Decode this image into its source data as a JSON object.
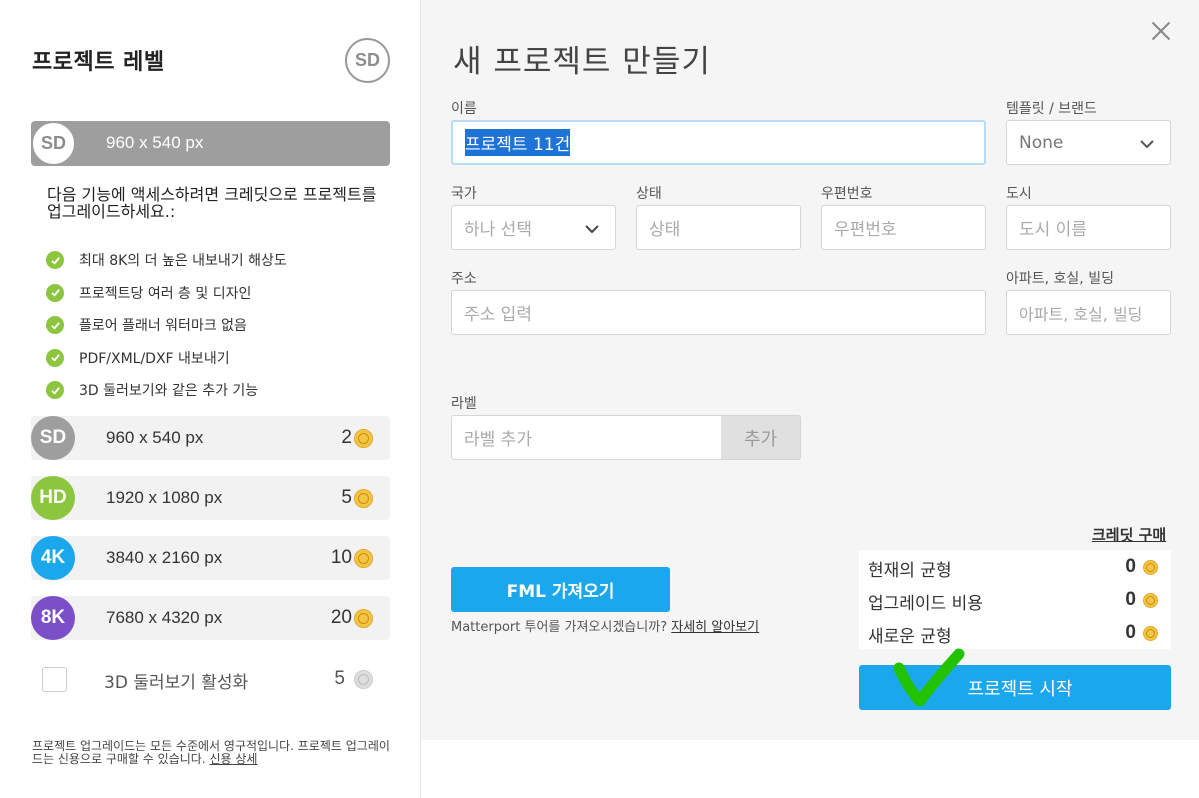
{
  "left": {
    "title": "프로젝트 레벨",
    "top_badge": "SD",
    "current": {
      "badge": "SD",
      "resolution": "960 x 540 px"
    },
    "upgrade_text": "다음 기능에 액세스하려면 크레딧으로 프로젝트를 업그레이드하세요.:",
    "features": [
      "최대 8K의 더 높은 내보내기 해상도",
      "프로젝트당 여러 층 및 디자인",
      "플로어 플래너 워터마크 없음",
      "PDF/XML/DXF 내보내기",
      "3D 둘러보기와 같은 추가 기능"
    ],
    "levels": [
      {
        "badge": "SD",
        "resolution": "960 x 540 px",
        "cost": "2",
        "color": "#9e9e9e"
      },
      {
        "badge": "HD",
        "resolution": "1920 x 1080 px",
        "cost": "5",
        "color": "#8cc63f"
      },
      {
        "badge": "4K",
        "resolution": "3840 x 2160 px",
        "cost": "10",
        "color": "#1aa7ec"
      },
      {
        "badge": "8K",
        "resolution": "7680 x 4320 px",
        "cost": "20",
        "color": "#7b4fc7"
      }
    ],
    "tour": {
      "label": "3D 둘러보기 활성화",
      "cost": "5"
    },
    "footnote": "프로젝트 업그레이드는 모든 수준에서 영구적입니다. 프로젝트 업그레이드는 신용으로 구매할 수 있습니다.",
    "footnote_link": "신용 상세"
  },
  "right": {
    "title": "새 프로젝트 만들기",
    "name": {
      "label": "이름",
      "value": "프로젝트 11건"
    },
    "template": {
      "label": "템플릿 / 브랜드",
      "value": "None"
    },
    "country": {
      "label": "국가",
      "value": "하나 선택"
    },
    "state": {
      "label": "상태",
      "placeholder": "상태"
    },
    "zip": {
      "label": "우편번호",
      "placeholder": "우편번호"
    },
    "city": {
      "label": "도시",
      "placeholder": "도시 이름"
    },
    "address": {
      "label": "주소",
      "placeholder": "주소 입력"
    },
    "apt": {
      "label": "아파트, 호실, 빌딩",
      "placeholder": "아파트, 호실, 빌딩"
    },
    "labels": {
      "label": "라벨",
      "placeholder": "라벨 추가",
      "add_button": "추가"
    },
    "fml_button": "FML 가져오기",
    "matterport_text": "Matterport 투어를 가져오시겠습니까?",
    "matterport_link": "자세히 알아보기",
    "buy_credits": "크레딧 구매",
    "balance_rows": [
      {
        "label": "현재의 균형",
        "value": "0"
      },
      {
        "label": "업그레이드 비용",
        "value": "0"
      },
      {
        "label": "새로운 균형",
        "value": "0"
      }
    ],
    "start_button": "프로젝트 시작"
  },
  "colors": {
    "accent": "#1aa7ec",
    "check": "#8cc63f",
    "mark": "#22c200"
  }
}
